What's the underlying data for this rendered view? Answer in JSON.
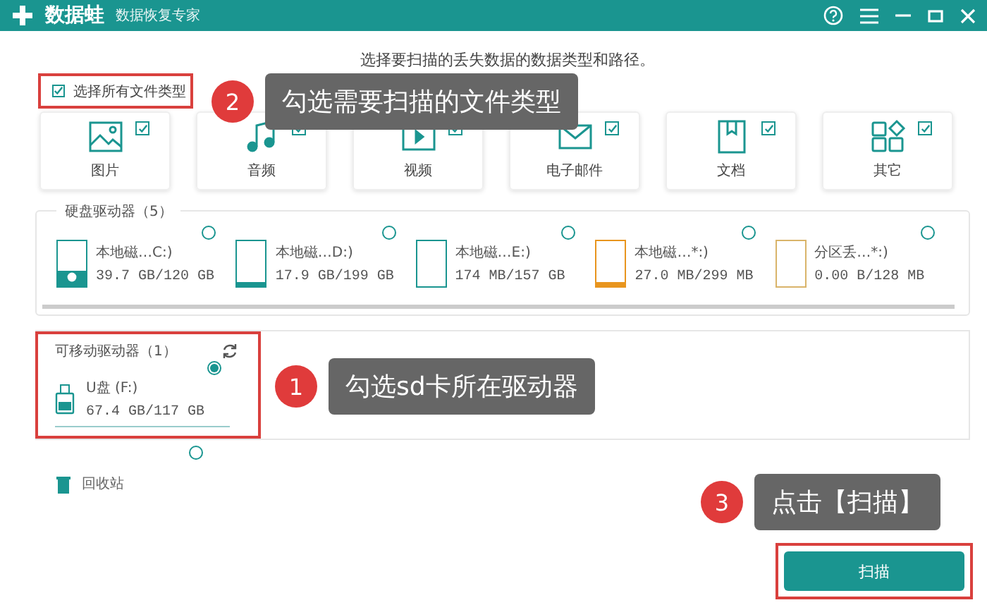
{
  "window": {
    "app_name": "数据蛙",
    "subtitle": "数据恢复专家"
  },
  "instruction": "选择要扫描的丢失数据的数据类型和路径。",
  "select_all": {
    "label": "选择所有文件类型",
    "checked": true
  },
  "file_types": [
    {
      "kind": "image",
      "label": "图片",
      "checked": true
    },
    {
      "kind": "audio",
      "label": "音频",
      "checked": true
    },
    {
      "kind": "video",
      "label": "视频",
      "checked": true
    },
    {
      "kind": "email",
      "label": "电子邮件",
      "checked": true
    },
    {
      "kind": "document",
      "label": "文档",
      "checked": true
    },
    {
      "kind": "other",
      "label": "其它",
      "checked": true
    }
  ],
  "hard_drives": {
    "title": "硬盘驱动器（5）",
    "drives": [
      {
        "name": "本地磁…C:)",
        "usage": "39.7 GB/120 GB",
        "level": 0.33,
        "color": "#1a9590",
        "system": true,
        "selected": false
      },
      {
        "name": "本地磁…D:)",
        "usage": "17.9 GB/199 GB",
        "level": 0.09,
        "color": "#1a9590",
        "system": false,
        "selected": false
      },
      {
        "name": "本地磁…E:)",
        "usage": "174 MB/157 GB",
        "level": 0,
        "color": "#1a9590",
        "system": false,
        "selected": false
      },
      {
        "name": "本地磁…*:)",
        "usage": "27.0 MB/299 MB",
        "level": 0.09,
        "color": "#e8951e",
        "system": false,
        "selected": false
      },
      {
        "name": "分区丢…*:)",
        "usage": "0.00  B/128 MB",
        "level": 0,
        "color": "#d9b46a",
        "system": false,
        "selected": false
      }
    ]
  },
  "removable_drives": {
    "title": "可移动驱动器（1）",
    "drives": [
      {
        "name": "U盘 (F:)",
        "usage": "67.4 GB/117 GB",
        "selected": true
      }
    ]
  },
  "other_locations": [
    {
      "name": "回收站",
      "selected": false
    }
  ],
  "annotations": [
    {
      "number": "2",
      "text": "勾选需要扫描的文件类型"
    },
    {
      "number": "1",
      "text": "勾选sd卡所在驱动器"
    },
    {
      "number": "3",
      "text": "点击【扫描】"
    }
  ],
  "scan_button": "扫描"
}
